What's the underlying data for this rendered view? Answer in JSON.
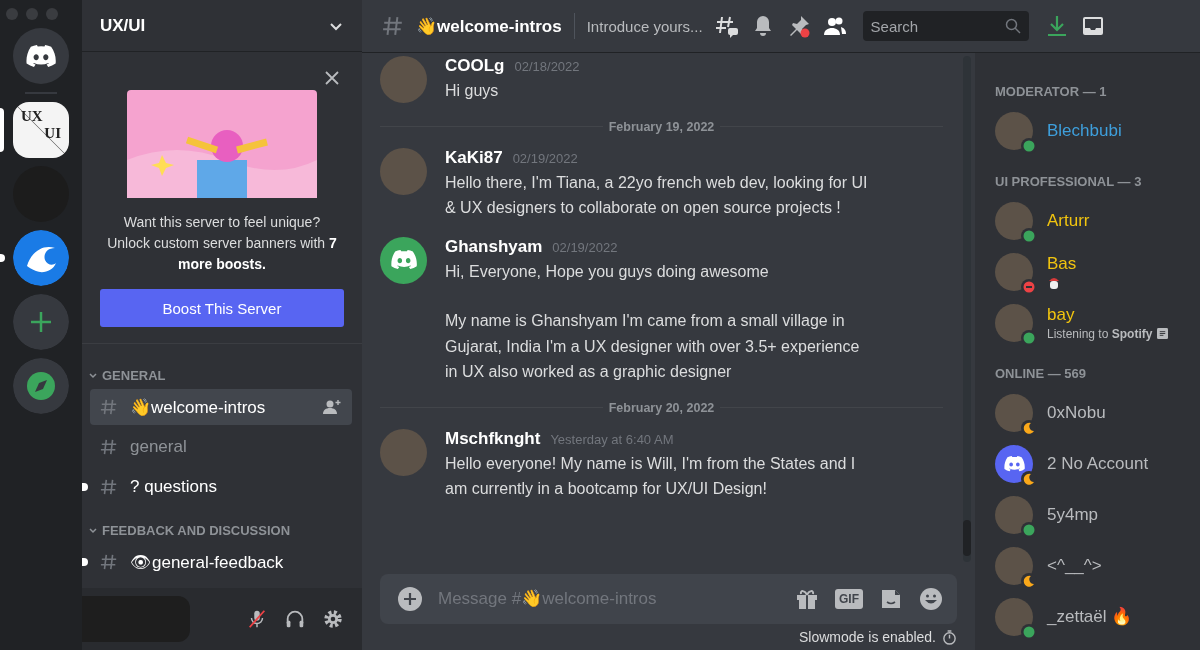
{
  "servers": [
    {
      "kind": "home",
      "selected": false,
      "unread": false
    },
    {
      "kind": "text",
      "top": "UX",
      "bottom": "UI",
      "selected": true,
      "unread": false
    },
    {
      "kind": "blank",
      "selected": false,
      "unread": false
    },
    {
      "kind": "image",
      "selected": false,
      "unread": true
    },
    {
      "kind": "add",
      "selected": false,
      "unread": false
    },
    {
      "kind": "explore",
      "selected": false,
      "unread": false
    }
  ],
  "server_name": "UX/UI",
  "boost": {
    "text": "Want this server to feel unique? Unlock custom server banners with **7 more boosts.**",
    "button": "Boost This Server"
  },
  "sections": [
    {
      "name": "GENERAL",
      "expanded": true,
      "channels": [
        {
          "name": "👋welcome-intros",
          "selected": true,
          "unread": false
        },
        {
          "name": "general",
          "selected": false,
          "unread": false
        },
        {
          "name": "? questions",
          "selected": false,
          "unread": true
        }
      ]
    },
    {
      "name": "FEEDBACK AND DISCUSSION",
      "expanded": true,
      "channels": [
        {
          "name": "👁general-feedback",
          "selected": false,
          "unread": true
        }
      ]
    }
  ],
  "user_panel": {
    "muted": true
  },
  "channel_header": {
    "name": "👋welcome-intros",
    "topic": "Introduce yours...",
    "search_placeholder": "Search",
    "pins_unread": true
  },
  "messages": [
    {
      "kind": "message",
      "author": "COOLg",
      "time": "02/18/2022",
      "avatar": {
        "kind": "photo"
      },
      "paragraphs": [
        "Hi guys"
      ]
    },
    {
      "kind": "divider",
      "text": "February 19, 2022"
    },
    {
      "kind": "message",
      "author": "KaKi87",
      "time": "02/19/2022",
      "avatar": {
        "kind": "photo"
      },
      "paragraphs": [
        "Hello there, I'm Tiana, a 22yo french web dev, looking for UI & UX designers to collaborate on open source projects !"
      ]
    },
    {
      "kind": "message",
      "author": "Ghanshyam",
      "time": "02/19/2022",
      "avatar": {
        "kind": "logo",
        "color": "#3ba55c"
      },
      "paragraphs": [
        "Hi, Everyone, Hope you guys doing awesome",
        "My name is Ghanshyam I'm came from a small village in Gujarat, India I'm a UX designer with over 3.5+ experience in UX also worked as a graphic designer"
      ]
    },
    {
      "kind": "divider",
      "text": "February 20, 2022"
    },
    {
      "kind": "message",
      "author": "Mschfknght",
      "time": "Yesterday at 6:40 AM",
      "avatar": {
        "kind": "photo"
      },
      "paragraphs": [
        "Hello everyone! My name is Will, I'm from the States and I am currently in a bootcamp for UX/UI Design!"
      ]
    }
  ],
  "composer": {
    "placeholder": "Message #👋welcome-intros",
    "gif_label": "GIF",
    "slowmode": "Slowmode is enabled."
  },
  "member_groups": [
    {
      "title": "MODERATOR — 1",
      "members": [
        {
          "name": "Blechbubi",
          "color": "#3e9fdc",
          "status": {
            "kind": "online"
          },
          "avatar": {
            "kind": "photo"
          }
        }
      ]
    },
    {
      "title": "UI PROFESSIONAL — 3",
      "members": [
        {
          "name": "Arturr",
          "color": "#f1c40f",
          "status": {
            "kind": "online"
          },
          "avatar": {
            "kind": "photo"
          }
        },
        {
          "name": "Bas",
          "color": "#f1c40f",
          "status": {
            "kind": "dnd"
          },
          "avatar": {
            "kind": "photo"
          },
          "status_emoji": true
        },
        {
          "name": "bay",
          "color": "#f1c40f",
          "status": {
            "kind": "online"
          },
          "avatar": {
            "kind": "photo"
          },
          "activity": "Listening to **Spotify**"
        }
      ]
    },
    {
      "title": "ONLINE — 569",
      "members": [
        {
          "name": "0xNobu",
          "color": "#b9bbbe",
          "status": {
            "kind": "idle"
          },
          "avatar": {
            "kind": "photo"
          }
        },
        {
          "name": "2 No Account",
          "color": "#b9bbbe",
          "status": {
            "kind": "idle"
          },
          "avatar": {
            "kind": "logo",
            "color": "#5865f2"
          }
        },
        {
          "name": "5y4mp",
          "color": "#b9bbbe",
          "status": {
            "kind": "online"
          },
          "avatar": {
            "kind": "photo"
          }
        },
        {
          "name": "<^__^>",
          "color": "#b9bbbe",
          "status": {
            "kind": "idle"
          },
          "avatar": {
            "kind": "photo"
          }
        },
        {
          "name": "_zettaël 🔥",
          "color": "#b9bbbe",
          "status": {
            "kind": "online"
          },
          "avatar": {
            "kind": "photo"
          }
        }
      ]
    }
  ]
}
